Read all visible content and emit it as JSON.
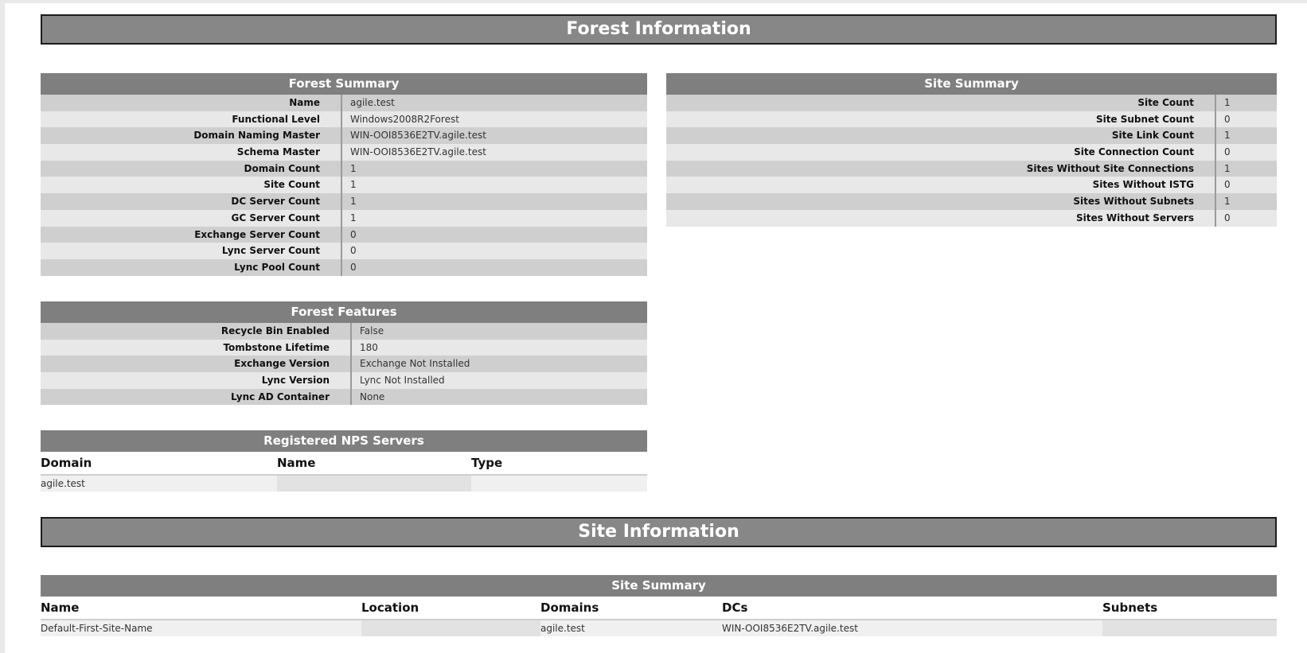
{
  "forest_section": {
    "title": "Forest Information"
  },
  "forest_summary": {
    "title": "Forest Summary",
    "rows": [
      {
        "label": "Name",
        "value": "agile.test"
      },
      {
        "label": "Functional Level",
        "value": "Windows2008R2Forest"
      },
      {
        "label": "Domain Naming Master",
        "value": "WIN-OOI8536E2TV.agile.test"
      },
      {
        "label": "Schema Master",
        "value": "WIN-OOI8536E2TV.agile.test"
      },
      {
        "label": "Domain Count",
        "value": "1"
      },
      {
        "label": "Site Count",
        "value": "1"
      },
      {
        "label": "DC Server Count",
        "value": "1"
      },
      {
        "label": "GC Server Count",
        "value": "1"
      },
      {
        "label": "Exchange Server Count",
        "value": "0"
      },
      {
        "label": "Lync Server Count",
        "value": "0"
      },
      {
        "label": "Lync Pool Count",
        "value": "0"
      }
    ]
  },
  "forest_features": {
    "title": "Forest Features",
    "rows": [
      {
        "label": "Recycle Bin Enabled",
        "value": "False"
      },
      {
        "label": "Tombstone Lifetime",
        "value": "180"
      },
      {
        "label": "Exchange Version",
        "value": "Exchange Not Installed"
      },
      {
        "label": "Lync Version",
        "value": "Lync Not Installed"
      },
      {
        "label": "Lync AD Container",
        "value": "None"
      }
    ]
  },
  "nps_servers": {
    "title": "Registered NPS Servers",
    "columns": [
      "Domain",
      "Name",
      "Type"
    ],
    "rows": [
      [
        "agile.test",
        "",
        ""
      ]
    ]
  },
  "site_summary_top": {
    "title": "Site Summary",
    "rows": [
      {
        "label": "Site Count",
        "value": "1"
      },
      {
        "label": "Site Subnet Count",
        "value": "0"
      },
      {
        "label": "Site Link Count",
        "value": "1"
      },
      {
        "label": "Site Connection Count",
        "value": "0"
      },
      {
        "label": "Sites Without Site Connections",
        "value": "1"
      },
      {
        "label": "Sites Without ISTG",
        "value": "0"
      },
      {
        "label": "Sites Without Subnets",
        "value": "1"
      },
      {
        "label": "Sites Without Servers",
        "value": "0"
      }
    ]
  },
  "site_section": {
    "title": "Site Information"
  },
  "site_summary_bottom": {
    "title": "Site Summary",
    "columns": [
      "Name",
      "Location",
      "Domains",
      "DCs",
      "Subnets"
    ],
    "rows": [
      [
        "Default-First-Site-Name",
        "",
        "agile.test",
        "WIN-OOI8536E2TV.agile.test",
        ""
      ]
    ]
  }
}
